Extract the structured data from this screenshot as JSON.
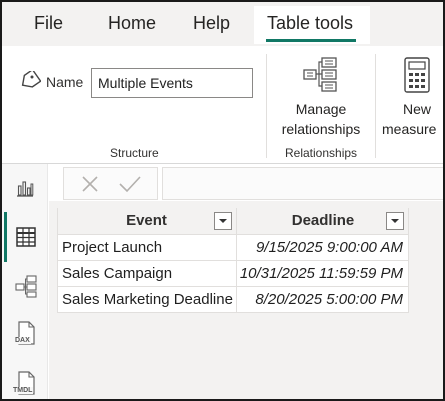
{
  "tabs": [
    {
      "label": "File"
    },
    {
      "label": "Home"
    },
    {
      "label": "Help"
    },
    {
      "label": "Table tools"
    }
  ],
  "ribbon": {
    "structure": {
      "name_label": "Name",
      "name_value": "Multiple Events",
      "group_label": "Structure"
    },
    "relationships": {
      "manage_line1": "Manage",
      "manage_line2": "relationships",
      "group_label": "Relationships"
    },
    "new_measure": {
      "line1": "New",
      "line2": "measure"
    }
  },
  "rail": {
    "items": [
      "report-view-icon",
      "table-view-icon",
      "model-view-icon",
      "dax-query-view-icon",
      "tmdl-view-icon"
    ],
    "dax_text": "DAX",
    "tmdl_text": "TMDL"
  },
  "table": {
    "columns": [
      "Event",
      "Deadline"
    ],
    "rows": [
      {
        "event": "Project Launch",
        "deadline": "9/15/2025 9:00:00 AM"
      },
      {
        "event": "Sales Campaign",
        "deadline": "10/31/2025 11:59:59 PM"
      },
      {
        "event": "Sales Marketing Deadline",
        "deadline": "8/20/2025 5:00:00 PM"
      }
    ]
  },
  "colors": {
    "accent": "#117865",
    "ribbon_bg": "#f3f2f1"
  }
}
